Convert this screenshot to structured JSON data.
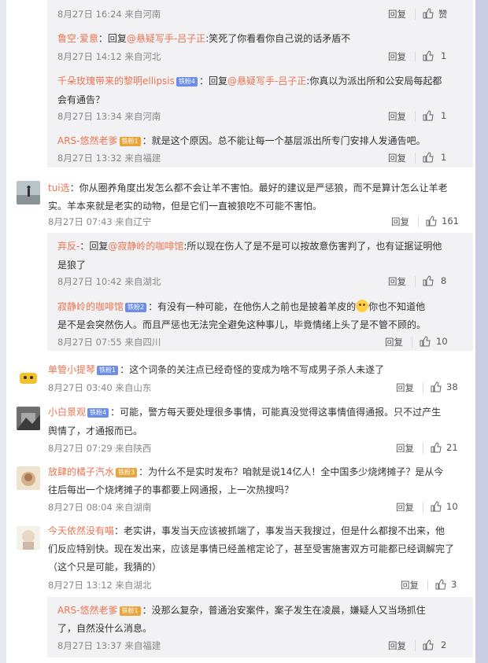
{
  "actions": {
    "reply": "回复",
    "like_icon": "thumbs-up-icon"
  },
  "comments": [
    {
      "id": "r1",
      "time": "8月27日 16:24 来自河南",
      "likes": "赞"
    },
    {
      "id": "r2",
      "user": "鲁空·爱意",
      "text": "：回复@悬疑写手-吕子正:笑死了你看看你自己说的话矛盾不",
      "time": "8月27日 14:12 来自河北",
      "likes": "1"
    },
    {
      "id": "r3",
      "user": "千朵玫瑰带来的黎明ellipsis",
      "badge": "铁粉4",
      "text_a": "：回复@悬疑写手-吕子正:你真以为派出所和公安局每起都",
      "text_b": "会有通告？",
      "time": "8月27日 13:34 来自河南",
      "likes": "1"
    },
    {
      "id": "r4",
      "user": "ARS-悠然老爹",
      "badge": "铁粉1",
      "text": "：就是这个原因。总不能让每一个基层派出所专门安排人发通告吧。",
      "time": "8月27日 13:32 来自福建",
      "likes": "1"
    },
    {
      "id": "c1",
      "user": "tui选",
      "text_a": "：你从圈养角度出发怎么都不会让羊不害怕。最好的建议是严惩狼，而不是算计怎么让羊老",
      "text_b": "实。羊本来就是老实的动物，但是它们一直被狼吃不可能不害怕。",
      "time": "8月27日 07:43 来自辽宁",
      "likes": "161"
    },
    {
      "id": "r5",
      "user": "弃反-",
      "text_a": "：回复@寂静岭的咖啡馆:所以现在伤人了是不是可以按故意伤害判了，也有证据证明他",
      "text_b": "是狼了",
      "time": "8月27日 10:42 来自湖北",
      "likes": "8"
    },
    {
      "id": "r6",
      "user": "寂静岭的咖啡馆",
      "badge": "铁粉2",
      "text_a1": "：有没有一种可能，在他伤人之前也是披着羊皮的",
      "text_a2": "你也不知道他",
      "text_b": "是不是会突然伤人。而且严惩也无法完全避免这种事儿，毕竟情绪上头了是不管不顾的。",
      "time": "8月27日 07:55 来自四川",
      "likes": "10"
    },
    {
      "id": "c2",
      "user": "单管小提琴",
      "badge": "铁粉1",
      "text": "：这个词条的关注点已经奇怪的变成为啥不写成男子杀人未遂了",
      "time": "8月27日 03:40 来自山东",
      "likes": "38"
    },
    {
      "id": "c3",
      "user": "小白景观",
      "badge": "铁粉4",
      "text_a": "：可能，警方每天要处理很多事情，可能真没觉得这事情值得通报。只不过产生",
      "text_b": "舆情了，才通报而已。",
      "time": "8月27日 07:29 来自陕西",
      "likes": "21"
    },
    {
      "id": "c4",
      "user": "放肆的橘子汽水",
      "badge": "铁粉3",
      "text_a": "：为什么不是实时发布？咱就是说14亿人！全中国多少烧烤摊子？是从今",
      "text_b": "往后每出一个烧烤摊子的事都要上网通报，上一次热搜吗？",
      "time": "8月27日 08:04 来自湖南",
      "likes": "10"
    },
    {
      "id": "c5",
      "user": "今天依然没有喵",
      "text_a": "：老实讲，事发当天应该被抓端了，事发当天我搜过，但是什么都搜不出来，他",
      "text_b": "们反应特别快。现在发出来，应该是事情已经盖棺定论了，甚至受害施害双方可能都已经调解完了",
      "text_c": "（这个只是可能，我猜的）",
      "time": "8月27日 13:12 来自湖北",
      "likes": "3"
    },
    {
      "id": "r7",
      "user": "ARS-悠然老爹",
      "badge": "铁粉1",
      "text_a": "：没那么复杂，普通治安案件，案子发生在凌晨，嫌疑人又当场抓住",
      "text_b": "了，自然没什么消息。",
      "time": "8月27日 13:37 来自福建",
      "likes": "2"
    }
  ]
}
